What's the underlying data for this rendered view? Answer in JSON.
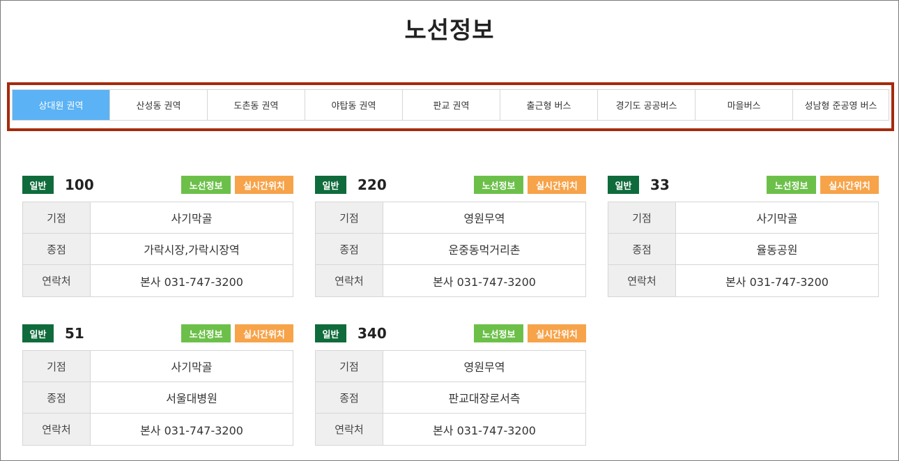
{
  "page_title": "노선정보",
  "tabs": [
    {
      "label": "상대원 권역"
    },
    {
      "label": "산성동 권역"
    },
    {
      "label": "도촌동 권역"
    },
    {
      "label": "야탑동 권역"
    },
    {
      "label": "판교 권역"
    },
    {
      "label": "출근형 버스"
    },
    {
      "label": "경기도 공공버스"
    },
    {
      "label": "마을버스"
    },
    {
      "label": "성남형 준공영 버스"
    }
  ],
  "active_tab": "상대원 권역",
  "labels": {
    "badge": "일반",
    "route_info_button": "노선정보",
    "live_location_button": "실시간위치",
    "origin": "기점",
    "terminus": "종점",
    "contact": "연락처"
  },
  "routes": [
    {
      "number": "100",
      "origin": "사기막골",
      "terminus": "가락시장,가락시장역",
      "contact": "본사 031-747-3200"
    },
    {
      "number": "220",
      "origin": "영원무역",
      "terminus": "운중동먹거리촌",
      "contact": "본사 031-747-3200"
    },
    {
      "number": "33",
      "origin": "사기막골",
      "terminus": "율동공원",
      "contact": "본사 031-747-3200"
    },
    {
      "number": "51",
      "origin": "사기막골",
      "terminus": "서울대병원",
      "contact": "본사 031-747-3200"
    },
    {
      "number": "340",
      "origin": "영원무역",
      "terminus": "판교대장로서측",
      "contact": "본사 031-747-3200"
    }
  ],
  "colors": {
    "active_tab_bg": "#5bb2f4",
    "highlight_border": "#a52a0e",
    "badge_bg": "#0f6b3b",
    "route_button_bg": "#6cc04a",
    "live_button_bg": "#f7a34a"
  }
}
